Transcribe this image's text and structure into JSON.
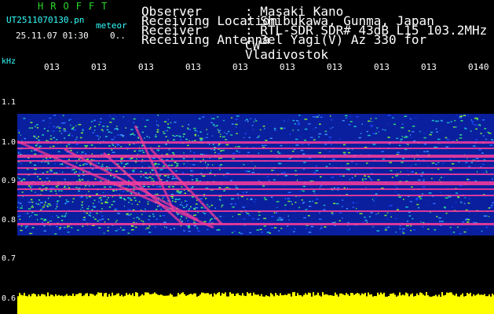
{
  "header": {
    "brand": "HROFFT",
    "filename": "UT2511070130.pn",
    "meteor": "meteor",
    "datetime": "25.11.07 01:30",
    "count": "0..",
    "fields": [
      {
        "label": "Observer",
        "value": ": Masaki Kano"
      },
      {
        "label": "Receiving Location",
        "value": ": Shibukawa, Gunma, Japan"
      },
      {
        "label": "Receiver",
        "value": ": RTL-SDR SDR# 43dB L15 103.2MHz CW"
      },
      {
        "label": "Receiving Antenna",
        "value": ": 3el Yagi(V) Az 330 for Vladivostok"
      }
    ]
  },
  "axes": {
    "y_unit": "kHz",
    "y_labels": [
      "1.1",
      "1.0",
      "0.9",
      "0.8",
      "0.7",
      "0.6"
    ],
    "time_labels": [
      "013",
      "013",
      "013",
      "013",
      "013",
      "013",
      "013",
      "013",
      "013",
      "0140"
    ]
  },
  "colors": {
    "background": "#000000",
    "noise_blue": "#1040ff",
    "signal_pink": "#ff3c9a",
    "floor_yellow": "#ffff00",
    "label_cyan": "#33ffff",
    "brand_green": "#28d828"
  }
}
